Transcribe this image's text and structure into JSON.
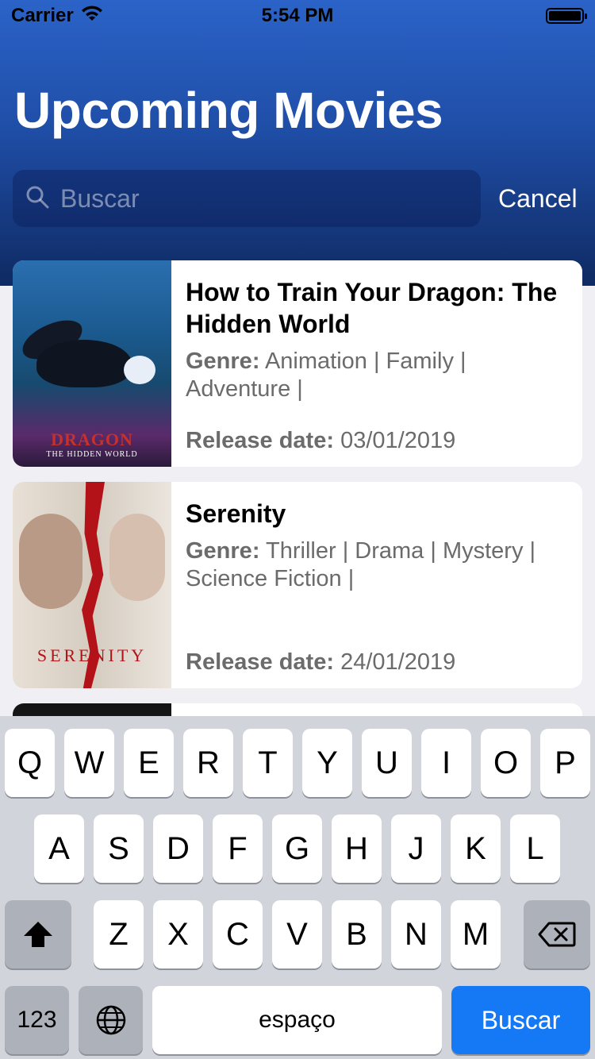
{
  "status_bar": {
    "carrier": "Carrier",
    "time": "5:54 PM"
  },
  "header": {
    "title": "Upcoming Movies",
    "search": {
      "placeholder": "Buscar",
      "value": ""
    },
    "cancel_label": "Cancel"
  },
  "movies": [
    {
      "title": "How to Train Your Dragon: The Hidden World",
      "genre_label": "Genre:",
      "genres": "Animation | Family | Adventure |",
      "release_label": "Release date:",
      "release_date": "03/01/2019",
      "poster_title": "DRAGON",
      "poster_subtitle": "THE HIDDEN WORLD"
    },
    {
      "title": "Serenity",
      "genre_label": "Genre:",
      "genres": "Thriller | Drama | Mystery | Science Fiction |",
      "release_label": "Release date:",
      "release_date": "24/01/2019",
      "poster_title": "SERENITY"
    }
  ],
  "keyboard": {
    "row1": [
      "Q",
      "W",
      "E",
      "R",
      "T",
      "Y",
      "U",
      "I",
      "O",
      "P"
    ],
    "row2": [
      "A",
      "S",
      "D",
      "F",
      "G",
      "H",
      "J",
      "K",
      "L"
    ],
    "row3": [
      "Z",
      "X",
      "C",
      "V",
      "B",
      "N",
      "M"
    ],
    "numbers_label": "123",
    "space_label": "espaço",
    "return_label": "Buscar"
  },
  "colors": {
    "accent": "#1579f6",
    "header_top": "#2b63c8",
    "header_bottom": "#0f2a63"
  }
}
